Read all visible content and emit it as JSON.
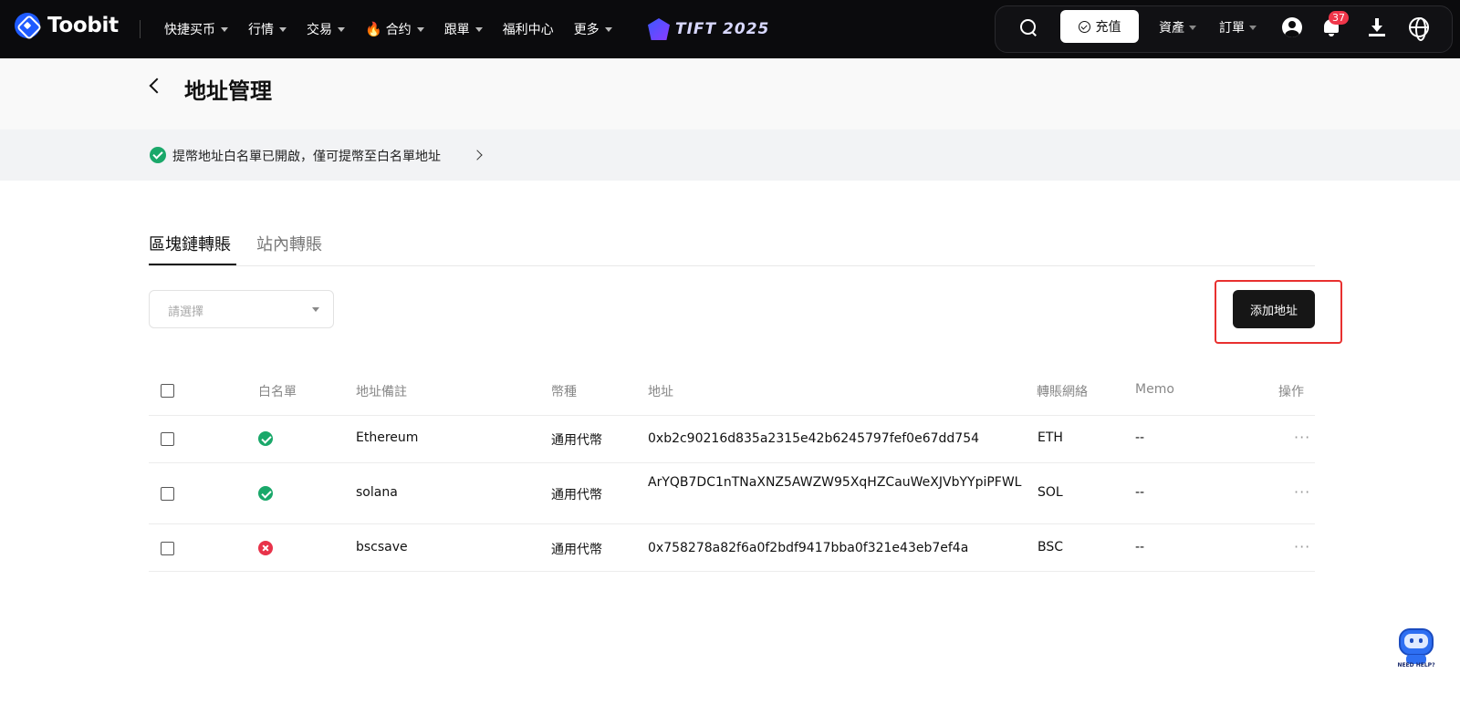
{
  "header": {
    "logo": "Toobit",
    "nav": [
      {
        "label": "快捷买币",
        "caret": true
      },
      {
        "label": "行情",
        "caret": true
      },
      {
        "label": "交易",
        "caret": true
      },
      {
        "label": "合约",
        "caret": true,
        "icon": "fire-icon"
      },
      {
        "label": "跟單",
        "caret": true
      },
      {
        "label": "福利中心",
        "caret": false
      },
      {
        "label": "更多",
        "caret": true
      }
    ],
    "event": "TIFT 2025",
    "deposit_label": "充值",
    "assets_label": "資產",
    "orders_label": "訂單",
    "notification_count": "37"
  },
  "page": {
    "title": "地址管理",
    "notice": "提幣地址白名單已開啟，僅可提幣至白名單地址"
  },
  "tabs": [
    {
      "label": "區塊鏈轉賬",
      "active": true
    },
    {
      "label": "站內轉賬",
      "active": false
    }
  ],
  "filter": {
    "placeholder": "請選擇"
  },
  "add_button": "添加地址",
  "table": {
    "headers": [
      "白名單",
      "地址備註",
      "幣種",
      "地址",
      "轉賬網絡",
      "Memo",
      "操作"
    ],
    "rows": [
      {
        "whitelisted": true,
        "note": "Ethereum",
        "coin": "通用代幣",
        "address": "0xb2c90216d835a2315e42b6245797fef0e67dd754",
        "network": "ETH",
        "memo": "--"
      },
      {
        "whitelisted": true,
        "note": "solana",
        "coin": "通用代幣",
        "address": "ArYQB7DC1nTNaXNZ5AWZW95XqHZCauWeXJVbYYpiPFWL",
        "network": "SOL",
        "memo": "--"
      },
      {
        "whitelisted": false,
        "note": "bscsave",
        "coin": "通用代幣",
        "address": "0x758278a82f6a0f2bdf9417bba0f321e43eb7ef4a",
        "network": "BSC",
        "memo": "--"
      }
    ],
    "more_glyph": "···"
  },
  "help": {
    "label": "NEED HELP?"
  },
  "colors": {
    "accent": "#1f5bff",
    "success": "#1aa86a",
    "danger": "#e8334a",
    "highlight": "#e8302f"
  }
}
